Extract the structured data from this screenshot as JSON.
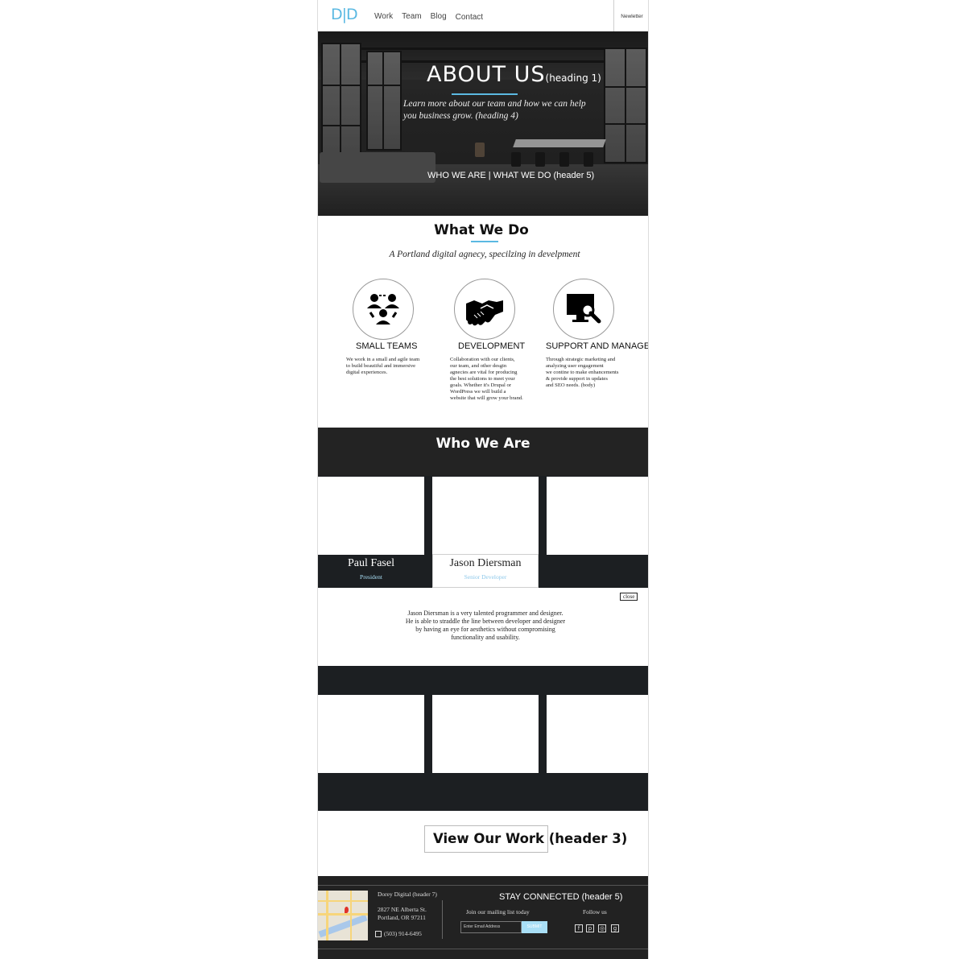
{
  "nav": {
    "logo": "D|D",
    "links": [
      "Work",
      "Team",
      "Blog",
      "Contact"
    ],
    "newsletter": "Newletter"
  },
  "hero": {
    "title": "ABOUT  US",
    "title_suffix": "(heading  1)",
    "lead": "Learn more about our team and how we can help you business grow. (heading 4)",
    "links": "WHO WE ARE  |  WHAT WE DO (header 5)"
  },
  "what_we_do": {
    "title": "What We Do",
    "subtitle": "A Portland digital agnecy, specilzing in develpment",
    "services": [
      {
        "title": "SMALL TEAMS",
        "icon": "team-icon",
        "body": "We work in a small and agile team\nto build beautiful and immersive\ndigital experiences."
      },
      {
        "title": "DEVELOPMENT",
        "icon": "handshake-icon",
        "body": "Collaboration with our clients,\nour team, and other desgin\nagnecies are vital for producing\n the best solutions to meet your\ngoals. Whether it's Drupal or\nWordPress we will build a\nwebsite that will grow your brand."
      },
      {
        "title": "SUPPORT AND MANAGE (",
        "icon": "monitor-wrench-icon",
        "body": "Through strategic marketing and\n analyzing user engagement\nwe contine to make enhancements\n& provide support in updates\nand SEO needs. (body)"
      }
    ]
  },
  "who_we_are": {
    "title": "Who We Are",
    "people": [
      {
        "name": "Paul Fasel",
        "role": "President"
      },
      {
        "name": "Jason Diersman",
        "role": "Senior Developer"
      }
    ],
    "bio": {
      "close": "close",
      "text": "Jason Diersman is a very talented programmer and designer.\nHe is able to straddle the line between developer and designer\nby having an eye for aesthetics without compromising\nfunctionality and usability."
    }
  },
  "view_work": {
    "label": "View Our Work (header 3)"
  },
  "footer": {
    "company": "Dorey Digital (header 7)",
    "address": "2827 NE Alberta St.\nPortland, OR 97211",
    "phone": "(503) 914-6495",
    "stay_connected": "STAY CONNECTED (header 5)",
    "mailing": "Join our mailing list today",
    "email_placeholder": "Enter Email Address",
    "submit": "SUBMIT",
    "follow": "Follow us",
    "social_icons": [
      "facebook-icon",
      "pinterest-icon",
      "instagram-icon",
      "google-plus-icon"
    ]
  },
  "colors": {
    "accent": "#5bb9e2",
    "dark": "#232323",
    "submit": "#a9dff6"
  }
}
